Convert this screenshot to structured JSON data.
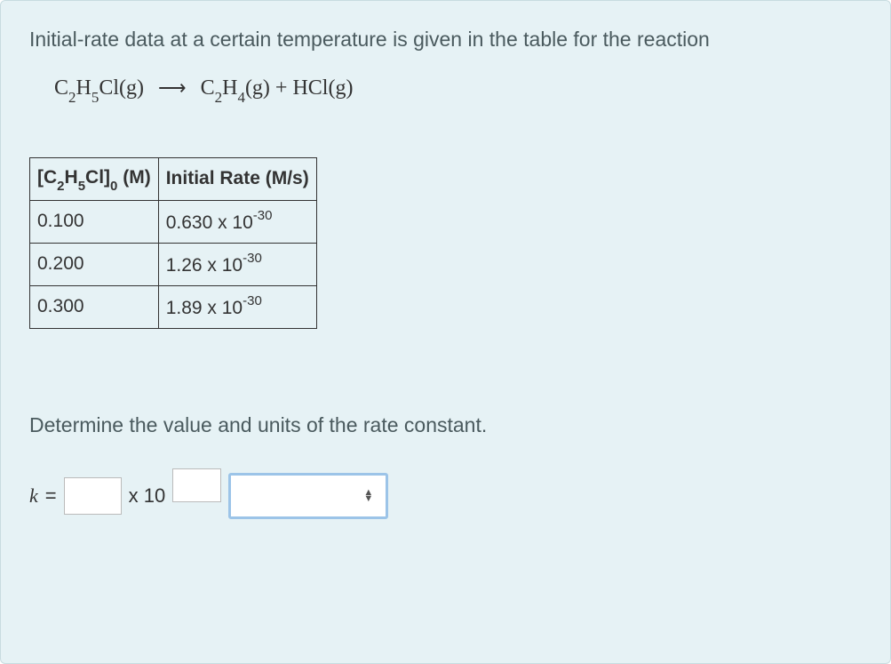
{
  "intro": "Initial-rate data at a certain temperature is given in the table for the reaction",
  "equation": {
    "reactant_base": "C",
    "reactant_sub1": "2",
    "reactant_mid1": "H",
    "reactant_sub2": "5",
    "reactant_end": "Cl(g)",
    "arrow": "⟶",
    "product1_base": "C",
    "product1_sub1": "2",
    "product1_mid": "H",
    "product1_sub2": "4",
    "product1_end": "(g)",
    "plus": " + ",
    "product2": "HCl(g)"
  },
  "table": {
    "headers": {
      "col1_prefix": "[C",
      "col1_sub1": "2",
      "col1_mid": "H",
      "col1_sub2": "5",
      "col1_end1": "Cl]",
      "col1_sub3": "0",
      "col1_unit": " (M)",
      "col2": "Initial Rate (M/s)"
    },
    "rows": [
      {
        "conc": "0.100",
        "rate_coef": "0.630 x 10",
        "rate_exp": "-30"
      },
      {
        "conc": "0.200",
        "rate_coef": "1.26 x 10",
        "rate_exp": "-30"
      },
      {
        "conc": "0.300",
        "rate_coef": "1.89 x 10",
        "rate_exp": "-30"
      }
    ]
  },
  "question": "Determine the value and units of the rate constant.",
  "answer": {
    "k_label": "k",
    "equals": " = ",
    "times_ten": " x 10",
    "coef_value": "",
    "exp_value": "",
    "units_value": ""
  }
}
